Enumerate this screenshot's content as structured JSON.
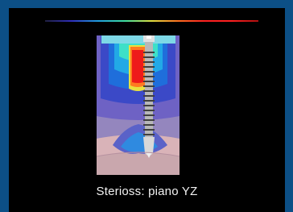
{
  "caption": "Sterioss: piano YZ",
  "colors": {
    "background": "#0c4f86",
    "panel": "#000000",
    "caption_text": "#f2f2f2"
  },
  "icons": {
    "figure": "implant-stress-map"
  }
}
